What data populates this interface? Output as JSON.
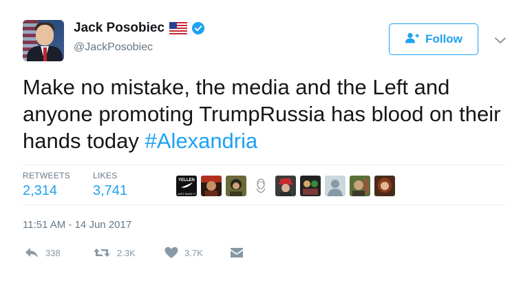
{
  "header": {
    "name": "Jack Posobiec",
    "handle": "@JackPosobiec",
    "follow_label": "Follow"
  },
  "tweet": {
    "text": "Make no mistake, the media and the Left and anyone promoting TrumpRussia has blood on their hands today ",
    "hashtag": "#Alexandria"
  },
  "stats": {
    "retweets_label": "RETWEETS",
    "retweets_count": "2,314",
    "likes_label": "LIKES",
    "likes_count": "3,741"
  },
  "likers": [
    {
      "name": "liker-avatar-yellen",
      "text_top": "YELLEN",
      "text_bottom": "JUST NUKE IT",
      "color": "#111111"
    },
    {
      "name": "liker-avatar-2",
      "color": "#7a3a20"
    },
    {
      "name": "liker-avatar-3",
      "color": "#6b6a3a"
    },
    {
      "name": "liker-avatar-4",
      "color": "#eeeeee"
    },
    {
      "name": "liker-avatar-5",
      "color": "#b32025"
    },
    {
      "name": "liker-avatar-6",
      "color": "#2d5a2a"
    },
    {
      "name": "liker-avatar-default",
      "color": "#ccd6dd"
    },
    {
      "name": "liker-avatar-8",
      "color": "#5a6e3a"
    },
    {
      "name": "liker-avatar-9",
      "color": "#8a4a2a"
    }
  ],
  "timestamp": "11:51 AM - 14 Jun 2017",
  "actions": {
    "reply_count": "338",
    "retweet_count": "2.3K",
    "like_count": "3.7K"
  },
  "colors": {
    "accent": "#1da1f2",
    "muted": "#657786",
    "icon_muted": "#8899a6"
  },
  "icons": {
    "flag": "us-flag-icon",
    "verified": "verified-badge-icon",
    "follow": "add-user-icon",
    "chevron": "chevron-down-icon",
    "reply": "reply-icon",
    "retweet": "retweet-icon",
    "like": "heart-icon",
    "dm": "direct-message-icon"
  }
}
